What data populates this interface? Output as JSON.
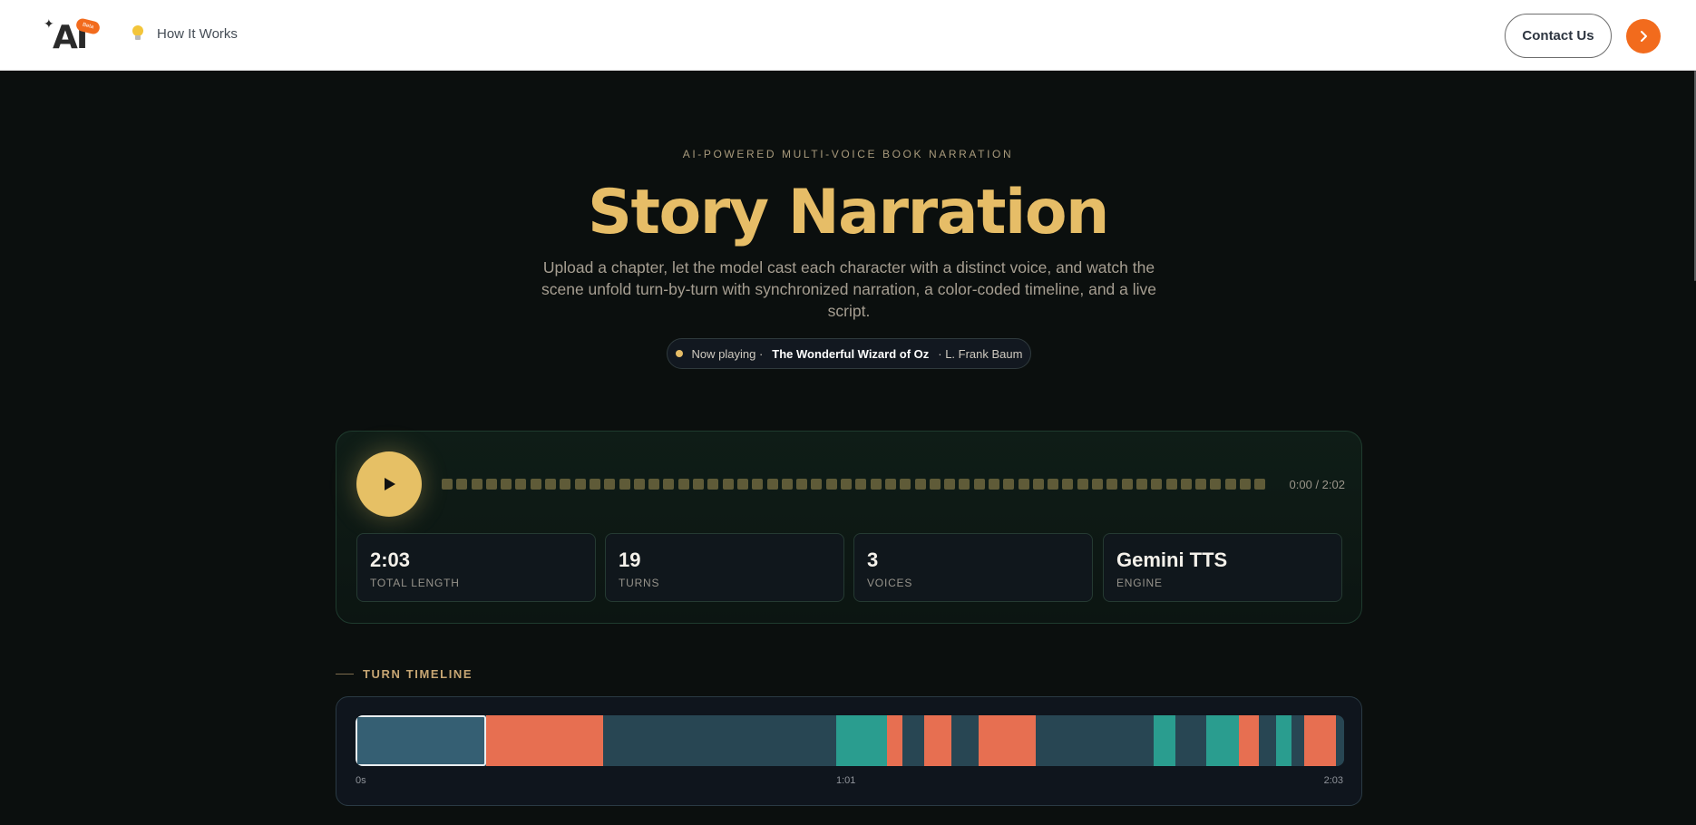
{
  "header": {
    "logo_text": "AI",
    "logo_badge": "Beta",
    "nav_how_it_works": "How It Works",
    "contact_label": "Contact Us",
    "arrow_glyph": "›"
  },
  "hero": {
    "eyebrow": "AI-POWERED MULTI-VOICE BOOK NARRATION",
    "title": "Story Narration",
    "subtitle": "Upload a chapter, let the model cast each character with a distinct voice, and watch the scene unfold turn-by-turn with synchronized narration, a color-coded timeline, and a live script.",
    "now_playing_label": "Now playing ·",
    "book_title": "The Wonderful Wizard of Oz",
    "author": "· L. Frank Baum"
  },
  "player": {
    "time_display": "0:00 / 2:02",
    "waveform_bar_count": 56,
    "progress": 0,
    "stats": [
      {
        "value": "2:03",
        "label": "TOTAL LENGTH"
      },
      {
        "value": "19",
        "label": "TURNS"
      },
      {
        "value": "3",
        "label": "VOICES"
      },
      {
        "value": "Gemini TTS",
        "label": "ENGINE"
      }
    ]
  },
  "timeline": {
    "heading": "TURN TIMELINE",
    "total_seconds": 123,
    "tick_labels": [
      "0s",
      "1:01",
      "2:03"
    ],
    "colors": {
      "narrator": "#284653",
      "voice_orange": "#e76f51",
      "voice_teal": "#2a9d8f",
      "active": "#355f73"
    },
    "turns": [
      {
        "start": 0,
        "end": 16.2,
        "voice": "narrator",
        "active": true
      },
      {
        "start": 16.2,
        "end": 30.8,
        "voice": "voice_orange"
      },
      {
        "start": 30.8,
        "end": 59.8,
        "voice": "narrator"
      },
      {
        "start": 59.8,
        "end": 66.1,
        "voice": "voice_teal"
      },
      {
        "start": 66.1,
        "end": 68.1,
        "voice": "voice_orange"
      },
      {
        "start": 68.1,
        "end": 70.8,
        "voice": "narrator"
      },
      {
        "start": 70.8,
        "end": 74.1,
        "voice": "voice_orange"
      },
      {
        "start": 74.1,
        "end": 77.5,
        "voice": "narrator"
      },
      {
        "start": 77.5,
        "end": 84.6,
        "voice": "voice_orange"
      },
      {
        "start": 84.6,
        "end": 99.3,
        "voice": "narrator"
      },
      {
        "start": 99.3,
        "end": 102.0,
        "voice": "voice_teal"
      },
      {
        "start": 102.0,
        "end": 105.9,
        "voice": "narrator"
      },
      {
        "start": 105.9,
        "end": 109.9,
        "voice": "voice_teal"
      },
      {
        "start": 109.9,
        "end": 112.4,
        "voice": "voice_orange"
      },
      {
        "start": 112.4,
        "end": 114.5,
        "voice": "narrator"
      },
      {
        "start": 114.5,
        "end": 116.5,
        "voice": "voice_teal"
      },
      {
        "start": 116.5,
        "end": 118.0,
        "voice": "narrator"
      },
      {
        "start": 118.0,
        "end": 122.0,
        "voice": "voice_orange"
      },
      {
        "start": 122.0,
        "end": 123.0,
        "voice": "narrator"
      }
    ]
  }
}
